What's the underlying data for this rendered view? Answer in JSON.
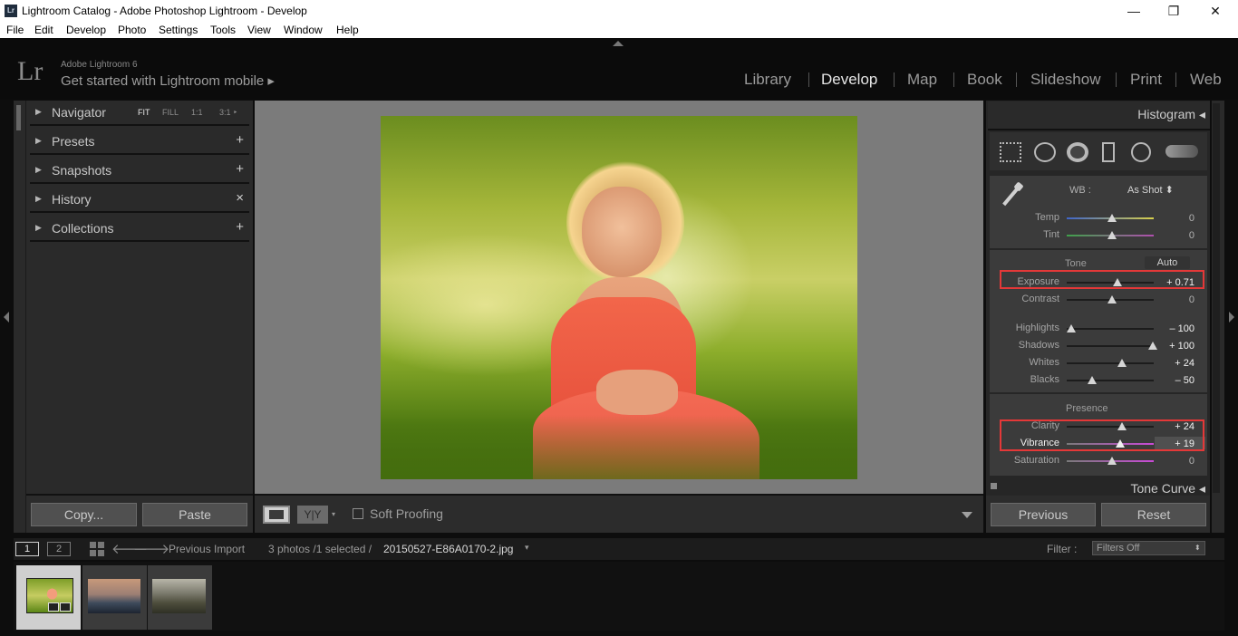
{
  "window": {
    "title": "Lightroom Catalog - Adobe Photoshop Lightroom - Develop",
    "app_icon": "Lr"
  },
  "menu": [
    "File",
    "Edit",
    "Develop",
    "Photo",
    "Settings",
    "Tools",
    "View",
    "Window",
    "Help"
  ],
  "identity": {
    "logo": "Lr",
    "product": "Adobe Lightroom 6",
    "mobile": "Get started with Lightroom mobile ▸"
  },
  "modules": [
    "Library",
    "Develop",
    "Map",
    "Book",
    "Slideshow",
    "Print",
    "Web"
  ],
  "active_module": "Develop",
  "left_panel": {
    "navigator": {
      "label": "Navigator",
      "opts": [
        "FIT",
        "FILL",
        "1:1",
        "3:1 ‣"
      ]
    },
    "presets": {
      "label": "Presets",
      "action": "+"
    },
    "snapshots": {
      "label": "Snapshots",
      "action": "+"
    },
    "history": {
      "label": "History",
      "action": "×"
    },
    "collections": {
      "label": "Collections",
      "action": "+"
    },
    "copy_label": "Copy...",
    "paste_label": "Paste"
  },
  "toolbar": {
    "view_a": "",
    "view_b": "Y|Y",
    "soft_proofing": "Soft Proofing"
  },
  "right_panel": {
    "histogram": "Histogram ◂",
    "wb_label": "WB :",
    "wb_value": "As Shot ⬍",
    "tone_label": "Tone",
    "auto_label": "Auto",
    "presence_label": "Presence",
    "tone_curve": "Tone Curve ◂",
    "previous_label": "Previous",
    "reset_label": "Reset",
    "sliders": [
      {
        "name": "Temp",
        "value": "0",
        "position": 0.5
      },
      {
        "name": "Tint",
        "value": "0",
        "position": 0.5
      },
      {
        "name": "Exposure",
        "value": "+ 0.71",
        "position": 0.57
      },
      {
        "name": "Contrast",
        "value": "0",
        "position": 0.5
      },
      {
        "name": "Highlights",
        "value": "– 100",
        "position": 0.0
      },
      {
        "name": "Shadows",
        "value": "+ 100",
        "position": 1.0
      },
      {
        "name": "Whites",
        "value": "+ 24",
        "position": 0.62
      },
      {
        "name": "Blacks",
        "value": "– 50",
        "position": 0.25
      },
      {
        "name": "Clarity",
        "value": "+ 24",
        "position": 0.62
      },
      {
        "name": "Vibrance",
        "value": "+ 19",
        "position": 0.6
      },
      {
        "name": "Saturation",
        "value": "0",
        "position": 0.5
      }
    ]
  },
  "filmstrip": {
    "page1": "1",
    "page2": "2",
    "source": "Previous Import",
    "info": "3 photos /1 selected /",
    "filename": "20150527-E86A0170-2.jpg",
    "filter_label": "Filter :",
    "filter_value": "Filters Off"
  }
}
